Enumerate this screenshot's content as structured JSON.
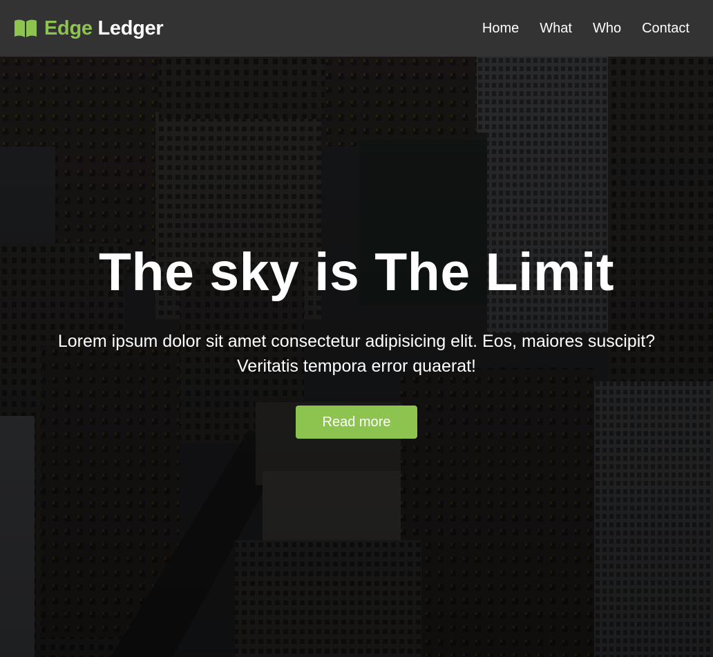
{
  "brand": {
    "accent": "Edge",
    "rest": "Ledger",
    "icon": "open-book-icon",
    "accent_color": "#8cc44f"
  },
  "nav": {
    "items": [
      {
        "label": "Home"
      },
      {
        "label": "What"
      },
      {
        "label": "Who"
      },
      {
        "label": "Contact"
      }
    ]
  },
  "hero": {
    "title": "The sky is The Limit",
    "text": "Lorem ipsum dolor sit amet consectetur adipisicing elit. Eos, maiores suscipit? Veritatis tempora error quaerat!",
    "button_label": "Read more",
    "background": "night city skyline photo"
  },
  "colors": {
    "navbar": "#333333",
    "accent": "#8cc44f",
    "text": "#ffffff"
  }
}
